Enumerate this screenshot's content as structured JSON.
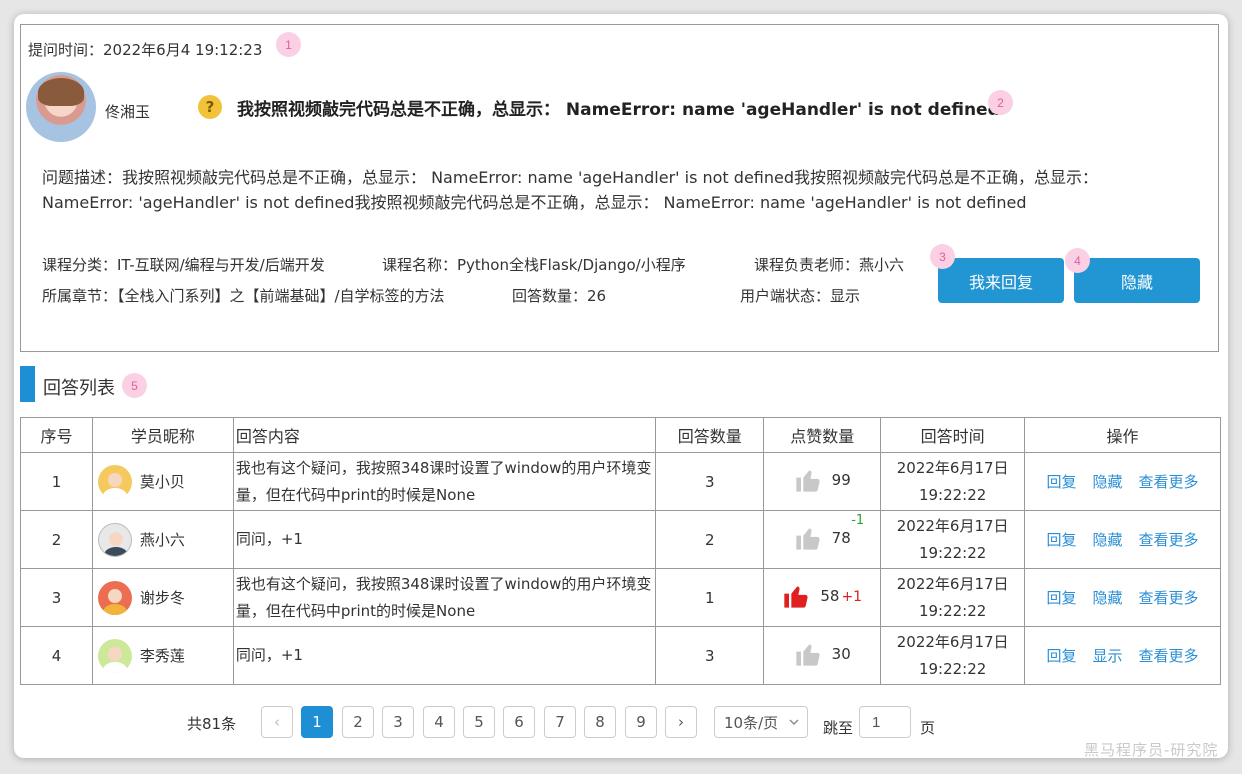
{
  "question": {
    "time_label": "提问时间：2022年6月4 19:12:23",
    "author": "佟湘玉",
    "title": "我按照视频敲完代码总是不正确，总显示： NameError: name 'ageHandler' is not defined",
    "description": "问题描述：我按照视频敲完代码总是不正确，总显示： NameError: name 'ageHandler' is not defined我按照视频敲完代码总是不正确，总显示： NameError: 'ageHandler' is not defined我按照视频敲完代码总是不正确，总显示： NameError: name 'ageHandler' is not defined",
    "category": "课程分类：IT-互联网/编程与开发/后端开发",
    "course": "课程名称：Python全栈Flask/Django/小程序",
    "teacher": "课程负责老师：燕小六",
    "chapter": "所属章节：【全栈入门系列】之【前端基础】/自学标签的方法",
    "answer_count": "回答数量：26",
    "status": "用户端状态：显示",
    "reply_button": "我来回复",
    "hide_button": "隐藏"
  },
  "markers": [
    "1",
    "2",
    "3",
    "4",
    "5"
  ],
  "answers_section": {
    "title": "回答列表",
    "columns": [
      "序号",
      "学员昵称",
      "回答内容",
      "回答数量",
      "点赞数量",
      "回答时间",
      "操作"
    ],
    "rows": [
      {
        "index": "1",
        "nickname": "莫小贝",
        "content": "我也有这个疑问，我按照348课时设置了window的用户环境变量，但在代码中print的时候是None",
        "reply_count": "3",
        "likes": "99",
        "delta": "",
        "liked": false,
        "time": "2022年6月17日 19:22:22",
        "ops": [
          "回复",
          "隐藏",
          "查看更多"
        ]
      },
      {
        "index": "2",
        "nickname": "燕小六",
        "content": "同问，+1",
        "reply_count": "2",
        "likes": "78",
        "delta": "-1",
        "liked": false,
        "time": "2022年6月17日 19:22:22",
        "ops": [
          "回复",
          "隐藏",
          "查看更多"
        ]
      },
      {
        "index": "3",
        "nickname": "谢步冬",
        "content": "我也有这个疑问，我按照348课时设置了window的用户环境变量，但在代码中print的时候是None",
        "reply_count": "1",
        "likes": "58",
        "delta": "+1",
        "liked": true,
        "time": "2022年6月17日 19:22:22",
        "ops": [
          "回复",
          "隐藏",
          "查看更多"
        ]
      },
      {
        "index": "4",
        "nickname": "李秀莲",
        "content": "同问，+1",
        "reply_count": "3",
        "likes": "30",
        "delta": "",
        "liked": false,
        "time": "2022年6月17日 19:22:22",
        "ops": [
          "回复",
          "显示",
          "查看更多"
        ]
      }
    ]
  },
  "pagination": {
    "total": "共81条",
    "pages": [
      "1",
      "2",
      "3",
      "4",
      "5",
      "6",
      "7",
      "8",
      "9"
    ],
    "current": "1",
    "prev": "‹",
    "next": "›",
    "page_size": "10条/页",
    "jump_label": "跳至",
    "jump_value": "1",
    "page_suffix": "页"
  },
  "watermark": "黑马程序员-研究院",
  "colors": {
    "primary": "#1e8fd4",
    "like_active": "#e02020",
    "like_inactive": "#c8c8c8",
    "delta_up": "#e02020",
    "delta_down": "#2aa52a"
  },
  "icons": {
    "question": "question-mark-icon",
    "like": "thumbs-up-icon",
    "dropdown": "chevron-down-icon"
  }
}
